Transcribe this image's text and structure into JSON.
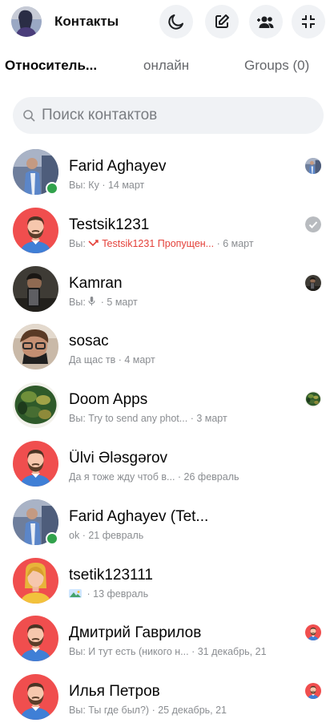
{
  "header": {
    "title": "Контакты"
  },
  "tabs": [
    {
      "label": "Относитель...",
      "active": true
    },
    {
      "label": "онлайн",
      "active": false
    },
    {
      "label": "Groups (0)",
      "active": false
    }
  ],
  "search": {
    "placeholder": "Поиск контактов"
  },
  "contacts": [
    {
      "name": "Farid Aghayev",
      "prefix": "Вы: ",
      "msg": "Ку",
      "date": "· 14 март",
      "avatar": "photo-man",
      "online": true,
      "status": "avatar"
    },
    {
      "name": "Testsik1231",
      "prefix": "Вы: ",
      "msg": "Testsik1231 Пропущен...",
      "date": "· 6 март",
      "avatar": "default-male",
      "online": false,
      "status": "read-check",
      "missed_call": true
    },
    {
      "name": "Kamran",
      "prefix": "Вы: ",
      "msg": "",
      "date": "· 5 март",
      "avatar": "photo-dark",
      "online": false,
      "status": "avatar",
      "voice": true
    },
    {
      "name": "sosac",
      "prefix": "",
      "msg": "Да щас тв",
      "date": "· 4 март",
      "avatar": "photo-glasses",
      "online": false,
      "status": "none"
    },
    {
      "name": "Doom Apps",
      "prefix": "Вы: ",
      "msg": "Try to send any phot...",
      "date": "· 3 март",
      "avatar": "photo-plant",
      "online": false,
      "status": "avatar"
    },
    {
      "name": "Ülvi Ələsgərov",
      "prefix": "",
      "msg": "Да я тоже жду чтоб в...",
      "date": "· 26 февраль",
      "avatar": "default-male",
      "online": false,
      "status": "none"
    },
    {
      "name": "Farid Aghayev (Tet...",
      "prefix": "",
      "msg": "ok",
      "date": "· 21 февраль",
      "avatar": "photo-man",
      "online": true,
      "status": "none"
    },
    {
      "name": "tsetik123111",
      "prefix": "",
      "msg": "",
      "date": "· 13 февраль",
      "avatar": "default-female",
      "online": false,
      "status": "none",
      "image": true
    },
    {
      "name": "Дмитрий Гаврилов",
      "prefix": "Вы: ",
      "msg": "И тут есть (никого н...",
      "date": "· 31 декабрь, 21",
      "avatar": "default-male",
      "online": false,
      "status": "avatar"
    },
    {
      "name": "Илья Петров",
      "prefix": "Вы: ",
      "msg": "Ты где был?)",
      "date": "· 25 декабрь, 21",
      "avatar": "default-male",
      "online": false,
      "status": "avatar"
    }
  ],
  "colors": {
    "online": "#31a24c",
    "missed_call": "#e4413a",
    "avatar_red": "#f04e4e",
    "shirt_blue": "#3f7fd6"
  }
}
